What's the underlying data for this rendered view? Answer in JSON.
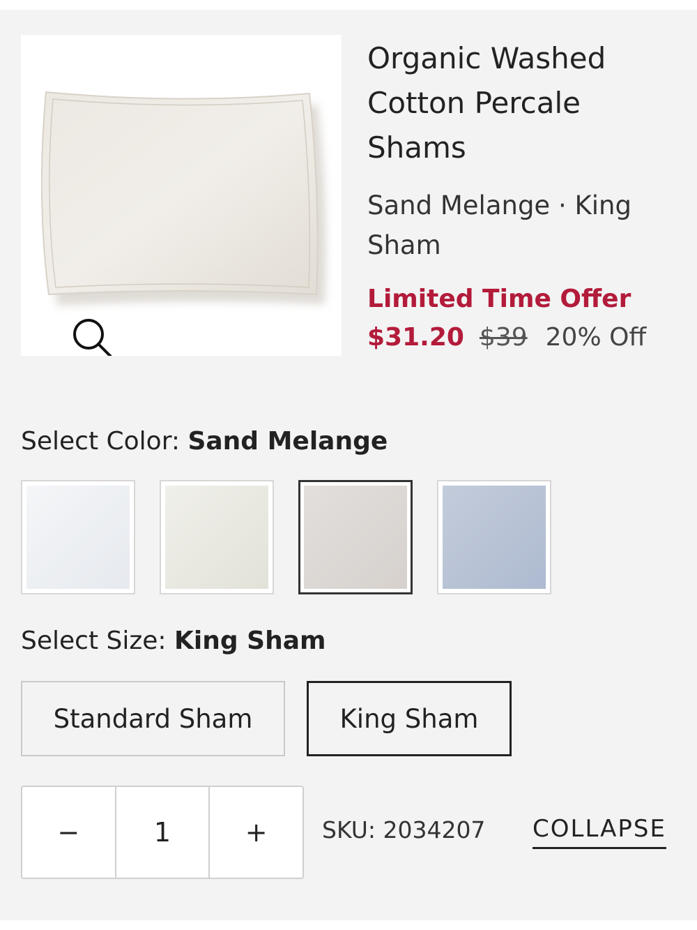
{
  "product": {
    "title": "Organic Washed Cotton Percale Shams",
    "variant": "Sand Melange · King Sham",
    "promo": "Limited Time Offer",
    "sale_price": "$31.20",
    "original_price": "$39",
    "discount": "20% Off",
    "image_icon": "zoom-icon"
  },
  "color": {
    "label": "Select Color:",
    "selected": "Sand Melange",
    "swatches": [
      {
        "fill": "#eef0f3"
      },
      {
        "fill": "#ecece4"
      },
      {
        "fill": "#ddd9d6",
        "selected": true
      },
      {
        "fill": "#b9c4d6"
      }
    ]
  },
  "size": {
    "label": "Select Size:",
    "selected": "King Sham",
    "options": [
      "Standard Sham",
      "King Sham"
    ]
  },
  "quantity": {
    "minus": "−",
    "value": "1",
    "plus": "+"
  },
  "sku": "SKU: 2034207",
  "collapse": "COLLAPSE",
  "colors": {
    "accent": "#b31b3a",
    "panel": "#f3f3f3"
  }
}
